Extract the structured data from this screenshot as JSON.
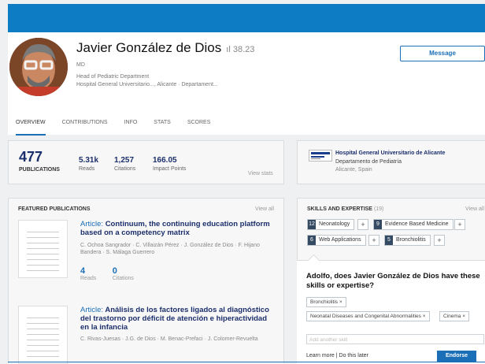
{
  "profile": {
    "name": "Javier González de Dios",
    "rg_score": "38.23",
    "degree": "MD",
    "position_line1": "Head of Pediatric Department",
    "position_line2": "Hospital General Universitario..., Alicante · Departament...",
    "message_label": "Message"
  },
  "tabs": [
    "OVERVIEW",
    "CONTRIBUTIONS",
    "INFO",
    "STATS",
    "SCORES"
  ],
  "stats": {
    "publications": {
      "value": "477",
      "label": "PUBLICATIONS"
    },
    "reads": {
      "value": "5.31k",
      "label": "Reads"
    },
    "citations": {
      "value": "1,257",
      "label": "Citations"
    },
    "impact": {
      "value": "166.05",
      "label": "Impact Points"
    },
    "view_stats": "View stats"
  },
  "institution": {
    "name": "Hospital General Universitario de Alicante",
    "department": "Departamento de Pediatría",
    "location": "Alicante, Spain"
  },
  "featured": {
    "title": "FEATURED PUBLICATIONS",
    "view_all": "View all",
    "items": [
      {
        "type": "Article:",
        "title": "Continuum, the continuing education platform based on a competency matrix",
        "authors": "C. Ochoa Sangrador · C. Villaizán Pérez · J. González de Dios · F. Hijano Bandera · S. Málaga Guerrero",
        "reads": "4",
        "reads_label": "Reads",
        "citations": "0",
        "citations_label": "Citations"
      },
      {
        "type": "Article:",
        "title": "Análisis de los factores ligados al diagnóstico del trastorno por déficit de atención e hiperactividad en la infancia",
        "authors": "C. Rivas-Juesas · J.G. de Dios · M. Benac-Prefaci · J. Colomer-Revuelta"
      }
    ]
  },
  "skills": {
    "title": "SKILLS AND EXPERTISE",
    "count": "(19)",
    "view_all": "View all",
    "items": [
      {
        "count": "12",
        "label": "Neonatology"
      },
      {
        "count": "9",
        "label": "Evidence Based Medicine"
      },
      {
        "count": "6",
        "label": "Web Applications"
      },
      {
        "count": "5",
        "label": "Bronchiolitis"
      }
    ],
    "plus": "+",
    "question": "Adolfo, does Javier González de Dios have these skills or expertise?",
    "tags": [
      "Bronchiolitis ×",
      "Neonatal Diseases and Congenital Abnormalities ×",
      "Cinema ×"
    ],
    "add_placeholder": "Add another skill",
    "learn_more": "Learn more",
    "separator": "|",
    "do_later": "Do this later",
    "endorse_label": "Endorse"
  },
  "colors": {
    "topbar": "#0e7cc5",
    "accent": "#1b6fb6",
    "title": "#1b2f6c"
  },
  "icons": {
    "avatar": "profile-photo",
    "thumb": "document-thumbnail-icon",
    "plus": "plus-icon",
    "bars": "rg-score-bars-icon"
  }
}
